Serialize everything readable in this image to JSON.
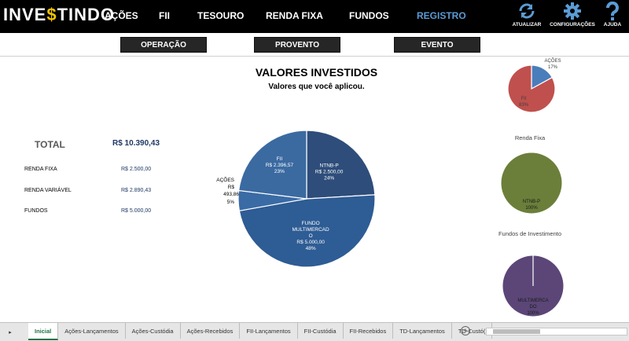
{
  "app": {
    "logo_pre": "INVE",
    "logo_dollar": "$",
    "logo_post": "TINDO"
  },
  "nav": {
    "items": [
      "AÇÕES",
      "FII",
      "TESOURO",
      "RENDA FIXA",
      "FUNDOS",
      "REGISTRO"
    ],
    "active": "REGISTRO",
    "active_color": "#5b9bd5"
  },
  "tools": [
    {
      "label": "ATUALIZAR",
      "icon": "refresh-icon"
    },
    {
      "label": "CONFIGURAÇÕES",
      "icon": "gear-icon"
    },
    {
      "label": "AJUDA",
      "icon": "question-icon"
    }
  ],
  "subnav": [
    "OPERAÇÃO",
    "PROVENTO",
    "EVENTO"
  ],
  "main": {
    "title": "VALORES INVESTIDOS",
    "subtitle": "Valores que você aplicou.",
    "total_label": "TOTAL",
    "total_value": "R$ 10.390,43",
    "rows": [
      {
        "label": "RENDA FIXA",
        "value": "R$ 2.500,00"
      },
      {
        "label": "RENDA VARIÁVEL",
        "value": "R$ 2.890,43"
      },
      {
        "label": "FUNDOS",
        "value": "R$ 5.000,00"
      }
    ]
  },
  "side": {
    "renda_fixa_title": "Renda Fixa",
    "fundos_title": "Fundos de Investimento"
  },
  "chart_data": [
    {
      "type": "pie",
      "title": "",
      "slices": [
        {
          "label": "NTNB-P",
          "value": 2500.0,
          "value_text": "R$ 2.500,00",
          "percent_text": "24%",
          "color": "#2e4d7a"
        },
        {
          "label": "FUNDO MULTIMERCADO",
          "value": 5000.0,
          "value_text": "R$ 5.000,00",
          "percent_text": "48%",
          "color": "#2e5c94"
        },
        {
          "label": "AÇÕES",
          "value": 493.86,
          "value_text": "R$ 493,86",
          "percent_text": "5%",
          "color": "#3a6ba5"
        },
        {
          "label": "FII",
          "value": 2396.57,
          "value_text": "R$ 2.396,57",
          "percent_text": "23%",
          "color": "#3b6aa1"
        }
      ]
    },
    {
      "type": "pie",
      "title": "",
      "slices": [
        {
          "label": "AÇÕES",
          "value": 17,
          "percent_text": "17%",
          "color": "#4a7ebb"
        },
        {
          "label": "FII",
          "value": 83,
          "percent_text": "83%",
          "color": "#c0504d"
        }
      ]
    },
    {
      "type": "pie",
      "title": "Renda Fixa",
      "slices": [
        {
          "label": "NTNB-P",
          "value": 100,
          "percent_text": "100%",
          "color": "#6b7f3a"
        }
      ]
    },
    {
      "type": "pie",
      "title": "Fundos de Investimento",
      "slices": [
        {
          "label": "MULTIMERCADO",
          "value": 100,
          "percent_text": "100%",
          "color": "#5b4677"
        }
      ]
    }
  ],
  "sheets": {
    "nav_glyph": "▸",
    "tabs": [
      "Inicial",
      "Ações-Lançamentos",
      "Ações-Custódia",
      "Ações-Recebidos",
      "FII-Lançamentos",
      "FII-Custódia",
      "FII-Recebidos",
      "TD-Lançamentos",
      "TD-Custó("
    ],
    "active": "Inicial",
    "add_glyph": "+"
  }
}
